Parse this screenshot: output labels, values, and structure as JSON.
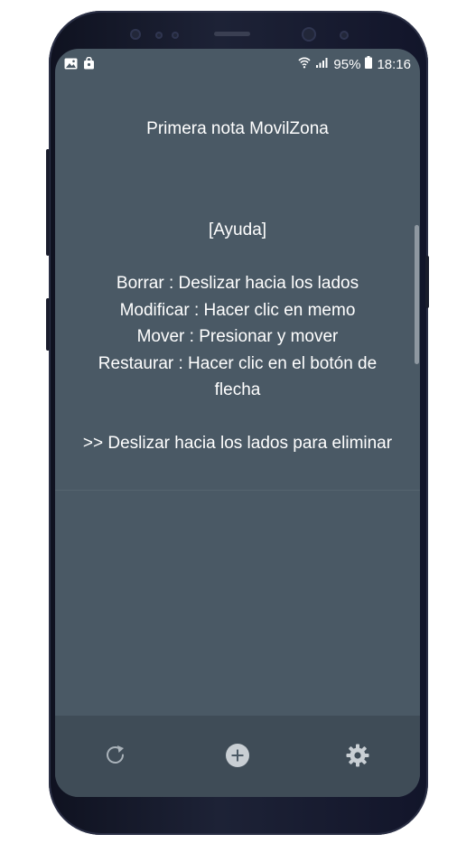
{
  "status_bar": {
    "battery": "95%",
    "time": "18:16",
    "left_icons": [
      "gallery-icon",
      "shopping-bag-icon"
    ],
    "right_icons": [
      "wifi-icon",
      "signal-icon",
      "battery-icon"
    ]
  },
  "note": {
    "title": "Primera nota MovilZona",
    "body_lines": [
      "[Ayuda]",
      "",
      "Borrar : Deslizar hacia los lados",
      "Modificar : Hacer clic en memo",
      "Mover : Presionar y mover",
      "Restaurar : Hacer clic en el botón de",
      "flecha",
      "",
      ">> Deslizar hacia los lados para eliminar"
    ]
  },
  "bottom_bar": {
    "buttons": [
      "restore-icon",
      "add-icon",
      "settings-icon"
    ]
  },
  "colors": {
    "screen_bg": "#4a5965",
    "bottom_bar_bg": "#3f4c57",
    "text": "#ffffff"
  }
}
